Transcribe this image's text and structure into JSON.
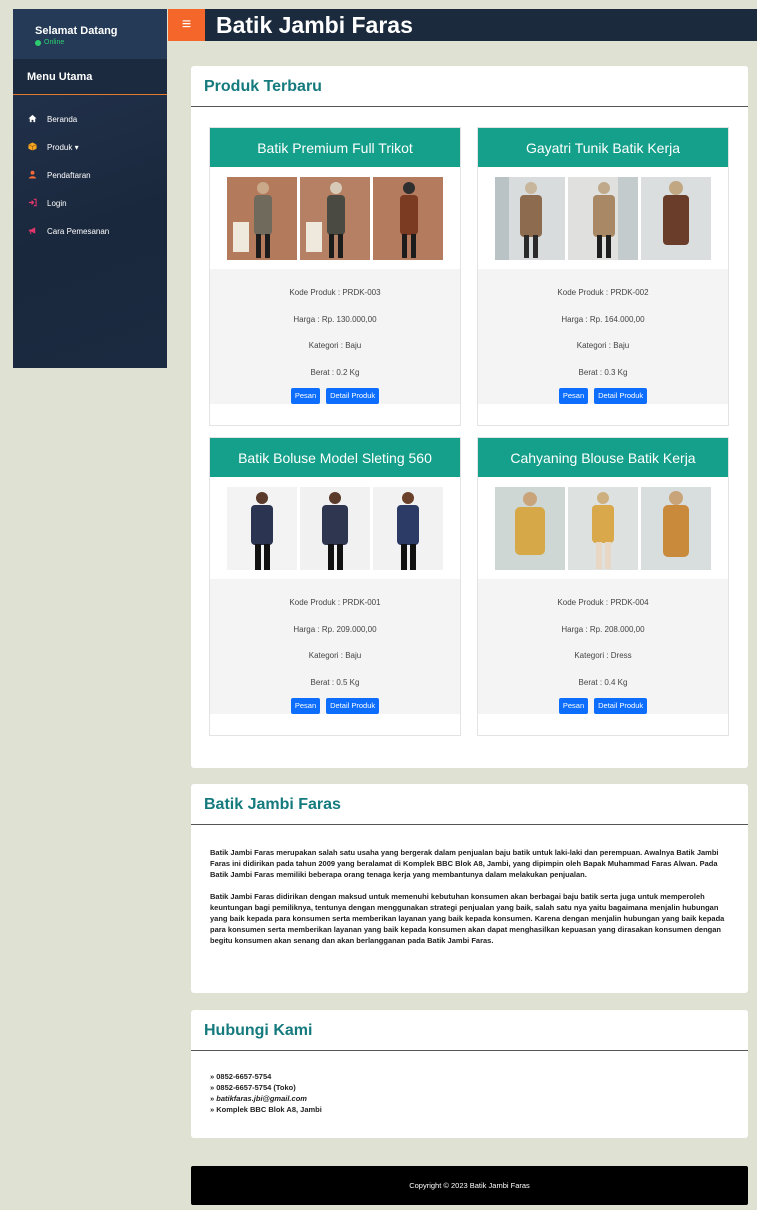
{
  "header": {
    "title": "Batik Jambi Faras",
    "menu_icon": "hamburger-icon"
  },
  "sidebar": {
    "welcome": "Selamat Datang",
    "status": "Online",
    "menu_title": "Menu Utama",
    "items": [
      {
        "label": "Beranda",
        "icon": "home-icon",
        "color": "#ffffff"
      },
      {
        "label": "Produk ▾",
        "icon": "box-icon",
        "color": "#f5a623"
      },
      {
        "label": "Pendaftaran",
        "icon": "user-icon",
        "color": "#f5693a"
      },
      {
        "label": "Login",
        "icon": "login-icon",
        "color": "#e4366c"
      },
      {
        "label": "Cara Pemesanan",
        "icon": "megaphone-icon",
        "color": "#e4366c"
      }
    ]
  },
  "products_section": {
    "title": "Produk Terbaru",
    "detail_label": "Detail Produk",
    "order_label": "Pesan",
    "items": [
      {
        "name": "Batik Premium Full Trikot",
        "code": "Kode Produk : PRDK-003",
        "price": "Harga : Rp. 130.000,00",
        "category": "Kategori : Baju",
        "weight": "Berat : 0.2 Kg"
      },
      {
        "name": "Gayatri Tunik Batik Kerja",
        "code": "Kode Produk : PRDK-002",
        "price": "Harga : Rp. 164.000,00",
        "category": "Kategori : Baju",
        "weight": "Berat : 0.3 Kg"
      },
      {
        "name": "Batik Boluse Model Sleting 560",
        "code": "Kode Produk : PRDK-001",
        "price": "Harga : Rp. 209.000,00",
        "category": "Kategori : Baju",
        "weight": "Berat : 0.5 Kg"
      },
      {
        "name": "Cahyaning Blouse Batik Kerja",
        "code": "Kode Produk : PRDK-004",
        "price": "Harga : Rp. 208.000,00",
        "category": "Kategori : Dress",
        "weight": "Berat : 0.4 Kg"
      }
    ]
  },
  "about": {
    "title": "Batik Jambi Faras",
    "p1": "Batik Jambi Faras merupakan salah satu usaha yang bergerak dalam penjualan baju batik untuk laki-laki dan perempuan. Awalnya Batik Jambi Faras ini didirikan pada tahun 2009 yang beralamat di Komplek BBC Blok A8, Jambi, yang dipimpin oleh Bapak Muhammad Faras Alwan. Pada Batik Jambi Faras memiliki beberapa orang tenaga kerja yang membantunya dalam melakukan penjualan.",
    "p2": "Batik Jambi Faras didirikan dengan maksud untuk memenuhi kebutuhan konsumen akan berbagai baju batik serta juga untuk memperoleh keuntungan bagi pemiliknya, tentunya dengan menggunakan strategi penjualan yang baik, salah satu nya yaitu bagaimana menjalin hubungan yang baik kepada para konsumen serta memberikan layanan yang baik kepada konsumen. Karena dengan menjalin hubungan yang baik kepada para konsumen serta memberikan layanan yang baik kepada konsumen akan dapat menghasilkan kepuasan yang dirasakan konsumen dengan begitu konsumen akan senang dan akan berlangganan pada Batik Jambi Faras."
  },
  "contact": {
    "title": "Hubungi Kami",
    "phone1": "» 0852-6657-5754",
    "phone2": "» 0852-6657-5754 (Toko)",
    "email_prefix": "» ",
    "email": "batikfaras.jbi@gmail.com",
    "address": "» Komplek BBC Blok A8, Jambi"
  },
  "footer": {
    "copyright": "Copyright © 2023 Batik Jambi Faras"
  },
  "colors": {
    "header_bg": "#1c2a3d",
    "accent": "#14a08a",
    "title_teal": "#157a7e",
    "button_blue": "#0d6efd",
    "toggle_orange": "#f4662a"
  }
}
